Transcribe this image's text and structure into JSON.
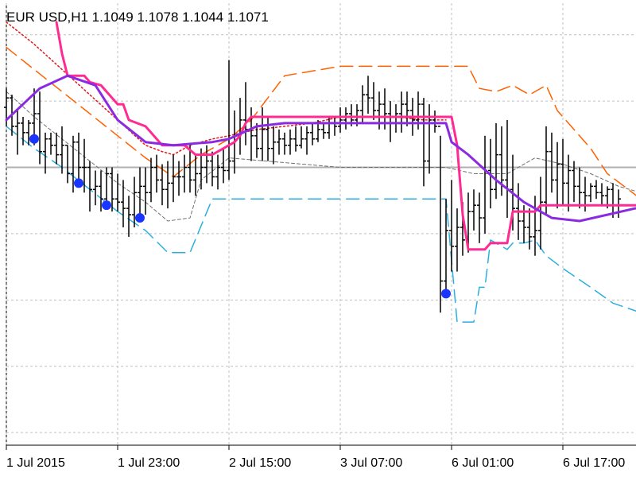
{
  "chart_data": {
    "type": "line",
    "title": "EUR USD,H1  1.1049 1.1078 1.1044 1.1071",
    "symbol": "EUR USD",
    "timeframe": "H1",
    "ohlc_header": {
      "open": "1.1049",
      "high": "1.1078",
      "low": "1.1044",
      "close": "1.1071"
    },
    "ylim": [
      1.0998,
      1.1138
    ],
    "grid": true,
    "x_tick_labels": [
      "1 Jul 2015",
      "1 Jul 23:00",
      "2 Jul 15:00",
      "3 Jul 07:00",
      "6 Jul 01:00",
      "6 Jul 17:00"
    ],
    "x_ticks": [
      {
        "bar": 0,
        "label": "1 Jul 2015"
      },
      {
        "bar": 20,
        "label": "1 Jul 23:00"
      },
      {
        "bar": 40,
        "label": "2 Jul 15:00"
      },
      {
        "bar": 60,
        "label": "3 Jul 07:00"
      },
      {
        "bar": 80,
        "label": "6 Jul 01:00"
      },
      {
        "bar": 100,
        "label": "6 Jul 17:00"
      }
    ],
    "hline": {
      "value": 1.1086,
      "color": "#b0b0b0"
    },
    "colors": {
      "candles": "#000000",
      "magenta_line": "#ff2a92",
      "purple_line": "#8a2be2",
      "orange_dashed": "#ff6000",
      "cyan_dashed": "#2ab0e0",
      "red_dotted": "#e01818",
      "gray_dashed": "#707070",
      "dots": "#1a35ff",
      "grid": "#c0c0c0"
    },
    "series": [
      {
        "values": [
          [
            0,
            1.1101
          ],
          [
            6,
            1.1111
          ],
          [
            11,
            1.1115
          ],
          [
            16,
            1.1112
          ],
          [
            20,
            1.1101
          ],
          [
            25,
            1.1094
          ],
          [
            30,
            1.1093
          ],
          [
            37,
            1.1094
          ],
          [
            40,
            1.1095
          ],
          [
            45,
            1.1099
          ],
          [
            50,
            1.11
          ],
          [
            55,
            1.11
          ],
          [
            60,
            1.11
          ],
          [
            65,
            1.11
          ],
          [
            70,
            1.11
          ],
          [
            74,
            1.11
          ],
          [
            79,
            1.11
          ],
          [
            80,
            1.1094
          ],
          [
            83,
            1.109
          ],
          [
            88,
            1.1082
          ],
          [
            93,
            1.1075
          ],
          [
            98,
            1.107
          ],
          [
            103,
            1.1069
          ],
          [
            108,
            1.1071
          ],
          [
            113,
            1.1073
          ],
          [
            114,
            1.1073
          ]
        ]
      },
      {
        "values": [
          [
            9,
            1.1132
          ],
          [
            10,
            1.1122
          ],
          [
            11,
            1.1115
          ],
          [
            14,
            1.1115
          ],
          [
            15,
            1.1113
          ],
          [
            17,
            1.1112
          ],
          [
            20,
            1.1106
          ],
          [
            21,
            1.1106
          ],
          [
            22,
            1.1101
          ],
          [
            25,
            1.1099
          ],
          [
            26,
            1.1097
          ],
          [
            28,
            1.1093
          ],
          [
            32,
            1.1093
          ],
          [
            34,
            1.109
          ],
          [
            37,
            1.109
          ],
          [
            39,
            1.1092
          ],
          [
            40,
            1.1093
          ],
          [
            41,
            1.1094
          ],
          [
            42,
            1.1096
          ],
          [
            43,
            1.11
          ],
          [
            44,
            1.1102
          ],
          [
            47,
            1.1102
          ],
          [
            60,
            1.1102
          ],
          [
            80,
            1.1102
          ],
          [
            81,
            1.1093
          ],
          [
            82,
            1.1071
          ],
          [
            83,
            1.106
          ],
          [
            86,
            1.106
          ],
          [
            87,
            1.1062
          ],
          [
            90,
            1.1062
          ],
          [
            91,
            1.1072
          ],
          [
            95,
            1.1072
          ],
          [
            96,
            1.1074
          ],
          [
            107,
            1.1074
          ],
          [
            114,
            1.1074
          ]
        ]
      },
      {
        "values": [
          [
            0,
            1.1124
          ],
          [
            10,
            1.111
          ],
          [
            20,
            1.1096
          ],
          [
            25,
            1.1089
          ],
          [
            30,
            1.1083
          ],
          [
            35,
            1.109
          ],
          [
            40,
            1.1095
          ],
          [
            44,
            1.1101
          ],
          [
            50,
            1.1115
          ],
          [
            60,
            1.1118
          ],
          [
            70,
            1.1118
          ],
          [
            80,
            1.1118
          ],
          [
            83,
            1.1118
          ],
          [
            85,
            1.1111
          ],
          [
            88,
            1.111
          ],
          [
            91,
            1.1112
          ],
          [
            94,
            1.1109
          ],
          [
            97,
            1.1112
          ],
          [
            99,
            1.1104
          ],
          [
            102,
            1.1098
          ],
          [
            105,
            1.1092
          ],
          [
            108,
            1.1084
          ],
          [
            111,
            1.108
          ],
          [
            114,
            1.1076
          ]
        ]
      },
      {
        "values": [
          [
            0,
            1.1099
          ],
          [
            5,
            1.1092
          ],
          [
            10,
            1.1086
          ],
          [
            15,
            1.1079
          ],
          [
            20,
            1.1072
          ],
          [
            25,
            1.1066
          ],
          [
            29,
            1.1059
          ],
          [
            33,
            1.1059
          ],
          [
            37,
            1.1076
          ],
          [
            40,
            1.1076
          ],
          [
            45,
            1.1076
          ],
          [
            55,
            1.1076
          ],
          [
            60,
            1.1076
          ],
          [
            70,
            1.1076
          ],
          [
            79,
            1.1076
          ],
          [
            81,
            1.1037
          ],
          [
            83,
            1.1037
          ],
          [
            84,
            1.1037
          ],
          [
            85,
            1.1048
          ],
          [
            86,
            1.1048
          ],
          [
            87,
            1.1063
          ],
          [
            88,
            1.1062
          ],
          [
            90,
            1.106
          ],
          [
            91,
            1.1062
          ],
          [
            93,
            1.1062
          ],
          [
            95,
            1.1063
          ],
          [
            97,
            1.1058
          ],
          [
            100,
            1.1054
          ],
          [
            105,
            1.1048
          ],
          [
            109,
            1.1043
          ],
          [
            114,
            1.104
          ]
        ]
      },
      {
        "values": [
          [
            0,
            1.1132
          ],
          [
            5,
            1.1125
          ],
          [
            10,
            1.1117
          ],
          [
            15,
            1.1109
          ],
          [
            20,
            1.1101
          ],
          [
            25,
            1.1093
          ],
          [
            28,
            1.1091
          ],
          [
            30,
            1.109
          ],
          [
            33,
            1.1093
          ],
          [
            37,
            1.1095
          ],
          [
            40,
            1.1096
          ],
          [
            45,
            1.1098
          ],
          [
            50,
            1.1099
          ],
          [
            55,
            1.11
          ],
          [
            60,
            1.1102
          ],
          [
            65,
            1.1102
          ],
          [
            70,
            1.1102
          ],
          [
            75,
            1.1101
          ],
          [
            79,
            1.1101
          ]
        ]
      },
      {
        "values": [
          [
            0,
            1.111
          ],
          [
            5,
            1.1102
          ],
          [
            10,
            1.1095
          ],
          [
            15,
            1.1088
          ],
          [
            20,
            1.1081
          ],
          [
            25,
            1.1075
          ],
          [
            29,
            1.1069
          ],
          [
            33,
            1.107
          ],
          [
            35,
            1.1082
          ],
          [
            40,
            1.1089
          ],
          [
            60,
            1.1086
          ],
          [
            79,
            1.1086
          ],
          [
            84,
            1.1084
          ],
          [
            90,
            1.1084
          ],
          [
            95,
            1.1089
          ],
          [
            100,
            1.1087
          ],
          [
            105,
            1.1084
          ],
          [
            110,
            1.108
          ],
          [
            114,
            1.1078
          ]
        ]
      }
    ],
    "candles": [
      [
        1.1105,
        1.1111,
        1.1099,
        1.1108
      ],
      [
        1.1108,
        1.1109,
        1.1096,
        1.1099
      ],
      [
        1.1099,
        1.1104,
        1.109,
        1.11
      ],
      [
        1.11,
        1.1102,
        1.1093,
        1.1097
      ],
      [
        1.1097,
        1.1101,
        1.1093,
        1.11
      ],
      [
        1.11,
        1.1111,
        1.1093,
        1.1103
      ],
      [
        1.1103,
        1.111,
        1.1087,
        1.1091
      ],
      [
        1.1091,
        1.1097,
        1.1084,
        1.1095
      ],
      [
        1.1095,
        1.1097,
        1.109,
        1.1093
      ],
      [
        1.1093,
        1.1097,
        1.1087,
        1.109
      ],
      [
        1.109,
        1.1099,
        1.1084,
        1.1093
      ],
      [
        1.1093,
        1.1093,
        1.1081,
        1.1084
      ],
      [
        1.1084,
        1.1096,
        1.1078,
        1.1094
      ],
      [
        1.1094,
        1.1097,
        1.1082,
        1.1086
      ],
      [
        1.1086,
        1.1095,
        1.1078,
        1.1086
      ],
      [
        1.1086,
        1.1088,
        1.1072,
        1.1079
      ],
      [
        1.1079,
        1.1085,
        1.1074,
        1.108
      ],
      [
        1.108,
        1.1085,
        1.1072,
        1.1076
      ],
      [
        1.1076,
        1.1086,
        1.1073,
        1.1084
      ],
      [
        1.1084,
        1.1086,
        1.1072,
        1.1076
      ],
      [
        1.1076,
        1.1084,
        1.1072,
        1.1075
      ],
      [
        1.1075,
        1.1082,
        1.1067,
        1.1073
      ],
      [
        1.1073,
        1.1077,
        1.1064,
        1.1071
      ],
      [
        1.1071,
        1.1083,
        1.1067,
        1.1078
      ],
      [
        1.1078,
        1.1086,
        1.107,
        1.108
      ],
      [
        1.108,
        1.1086,
        1.1071,
        1.1078
      ],
      [
        1.1078,
        1.1089,
        1.1075,
        1.1086
      ],
      [
        1.1086,
        1.109,
        1.1078,
        1.1082
      ],
      [
        1.1082,
        1.1087,
        1.1074,
        1.1079
      ],
      [
        1.1079,
        1.1088,
        1.1073,
        1.1081
      ],
      [
        1.1081,
        1.109,
        1.1075,
        1.1083
      ],
      [
        1.1083,
        1.1088,
        1.1077,
        1.1083
      ],
      [
        1.1083,
        1.109,
        1.1078,
        1.1086
      ],
      [
        1.1086,
        1.1093,
        1.1078,
        1.1082
      ],
      [
        1.1082,
        1.109,
        1.1077,
        1.1084
      ],
      [
        1.1084,
        1.1092,
        1.1079,
        1.1086
      ],
      [
        1.1086,
        1.1093,
        1.1081,
        1.1088
      ],
      [
        1.1088,
        1.1091,
        1.108,
        1.1083
      ],
      [
        1.1083,
        1.109,
        1.1079,
        1.1086
      ],
      [
        1.1086,
        1.1092,
        1.1081,
        1.1085
      ],
      [
        1.1085,
        1.112,
        1.1082,
        1.1088
      ],
      [
        1.1088,
        1.1104,
        1.1084,
        1.1096
      ],
      [
        1.1096,
        1.1108,
        1.109,
        1.1101
      ],
      [
        1.1101,
        1.1113,
        1.1093,
        1.1098
      ],
      [
        1.1098,
        1.1105,
        1.1088,
        1.1096
      ],
      [
        1.1096,
        1.11,
        1.1089,
        1.1092
      ],
      [
        1.1092,
        1.1105,
        1.1088,
        1.1098
      ],
      [
        1.1098,
        1.1102,
        1.1088,
        1.1092
      ],
      [
        1.1092,
        1.1099,
        1.1087,
        1.1094
      ],
      [
        1.1094,
        1.1098,
        1.109,
        1.1095
      ],
      [
        1.1095,
        1.1097,
        1.109,
        1.1093
      ],
      [
        1.1093,
        1.1098,
        1.109,
        1.1095
      ],
      [
        1.1095,
        1.1099,
        1.1091,
        1.1093
      ],
      [
        1.1093,
        1.1099,
        1.1092,
        1.1095
      ],
      [
        1.1095,
        1.1099,
        1.109,
        1.1097
      ],
      [
        1.1097,
        1.11,
        1.1093,
        1.1095
      ],
      [
        1.1095,
        1.1101,
        1.1094,
        1.1098
      ],
      [
        1.1098,
        1.11,
        1.1095,
        1.1097
      ],
      [
        1.1097,
        1.1102,
        1.1095,
        1.11
      ],
      [
        1.11,
        1.1102,
        1.1096,
        1.1099
      ],
      [
        1.1099,
        1.1105,
        1.1097,
        1.1101
      ],
      [
        1.1101,
        1.1105,
        1.1098,
        1.1103
      ],
      [
        1.1103,
        1.1106,
        1.1099,
        1.1101
      ],
      [
        1.1101,
        1.1106,
        1.1099,
        1.1104
      ],
      [
        1.1104,
        1.1112,
        1.11,
        1.1109
      ],
      [
        1.1109,
        1.1115,
        1.1103,
        1.1108
      ],
      [
        1.1108,
        1.1113,
        1.1101,
        1.1104
      ],
      [
        1.1104,
        1.111,
        1.1098,
        1.1106
      ],
      [
        1.1106,
        1.1111,
        1.1098,
        1.1103
      ],
      [
        1.1103,
        1.1107,
        1.1094,
        1.11
      ],
      [
        1.11,
        1.1106,
        1.1097,
        1.1103
      ],
      [
        1.1103,
        1.111,
        1.1097,
        1.1106
      ],
      [
        1.1106,
        1.111,
        1.1099,
        1.1104
      ],
      [
        1.1104,
        1.1108,
        1.1096,
        1.1101
      ],
      [
        1.1101,
        1.111,
        1.1098,
        1.1106
      ],
      [
        1.1106,
        1.1108,
        1.108,
        1.1088
      ],
      [
        1.1088,
        1.1106,
        1.1084,
        1.1101
      ],
      [
        1.1101,
        1.1104,
        1.1097,
        1.1099
      ],
      [
        1.1099,
        1.1096,
        1.104,
        1.105
      ],
      [
        1.105,
        1.1076,
        1.1047,
        1.1066
      ],
      [
        1.1066,
        1.1082,
        1.1053,
        1.1061
      ],
      [
        1.1061,
        1.1073,
        1.1053,
        1.1067
      ],
      [
        1.1067,
        1.1075,
        1.1058,
        1.1063
      ],
      [
        1.1063,
        1.1078,
        1.1059,
        1.1072
      ],
      [
        1.1072,
        1.1079,
        1.1066,
        1.1074
      ],
      [
        1.1074,
        1.1078,
        1.1062,
        1.107
      ],
      [
        1.107,
        1.1096,
        1.1065,
        1.1085
      ],
      [
        1.1085,
        1.1095,
        1.1073,
        1.1079
      ],
      [
        1.1079,
        1.11,
        1.1076,
        1.109
      ],
      [
        1.109,
        1.1099,
        1.1077,
        1.1082
      ],
      [
        1.1082,
        1.1101,
        1.107,
        1.1079
      ],
      [
        1.1079,
        1.109,
        1.1066,
        1.1073
      ],
      [
        1.1073,
        1.1081,
        1.1063,
        1.1069
      ],
      [
        1.1069,
        1.1074,
        1.1062,
        1.1067
      ],
      [
        1.1067,
        1.1073,
        1.106,
        1.1064
      ],
      [
        1.1064,
        1.1077,
        1.1058,
        1.1066
      ],
      [
        1.1066,
        1.1083,
        1.106,
        1.1075
      ],
      [
        1.1075,
        1.1099,
        1.1071,
        1.1091
      ],
      [
        1.1091,
        1.1097,
        1.1078,
        1.1082
      ],
      [
        1.1082,
        1.1094,
        1.1073,
        1.1087
      ],
      [
        1.1087,
        1.1095,
        1.1074,
        1.1081
      ],
      [
        1.1081,
        1.109,
        1.1072,
        1.1085
      ],
      [
        1.1085,
        1.1088,
        1.1075,
        1.108
      ],
      [
        1.108,
        1.1086,
        1.1073,
        1.1078
      ],
      [
        1.1078,
        1.1083,
        1.1072,
        1.1077
      ],
      [
        1.1077,
        1.1081,
        1.1075,
        1.108
      ],
      [
        1.108,
        1.1082,
        1.1076,
        1.1078
      ],
      [
        1.1078,
        1.1081,
        1.1074,
        1.1077
      ],
      [
        1.1077,
        1.108,
        1.1073,
        1.1079
      ],
      [
        1.1079,
        1.1081,
        1.107,
        1.1074
      ],
      [
        1.1074,
        1.1079,
        1.107,
        1.1076
      ]
    ],
    "dots": [
      [
        5,
        1.1095
      ],
      [
        13,
        1.1081
      ],
      [
        18,
        1.1074
      ],
      [
        24,
        1.107
      ],
      [
        79,
        1.1046
      ]
    ]
  }
}
